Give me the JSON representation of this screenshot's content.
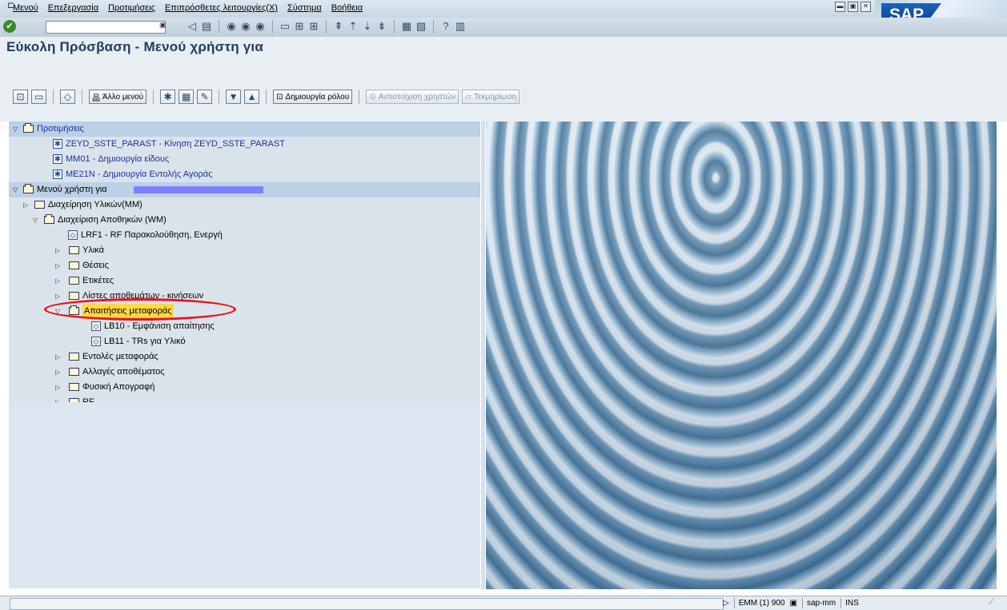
{
  "menubar": {
    "items": [
      "Μενού",
      "Επεξεργασία",
      "Προτιμήσεις",
      "Επιπρόσθετες λειτουργίες(X)",
      "Σύστημα",
      "Βοήθεια"
    ],
    "logo": "SAP"
  },
  "toolbar": {
    "command_value": ""
  },
  "title": "Εύκολη Πρόσβαση - Μενού χρήστη για",
  "app_toolbar": {
    "other_menu": "Άλλο μενού",
    "create_role": "Δημιουργία ρόλου",
    "assign_users": "Αντιστοίχιση χρηστών",
    "documentation": "Τεκμηρίωση"
  },
  "tree": {
    "favorites": "Προτιμήσεις",
    "fav1": "ZEYD_SSTE_PARAST - Κίνηση ZEYD_SSTE_PARAST",
    "fav2": "MM01 - Δημιουργία είδους",
    "fav3": "ME21N - Δημιουργία Εντολής Αγοράς",
    "user_menu": "Μενού χρήστη για",
    "mm": "Διαχείρηση Υλικών(MM)",
    "wm": "Διαχείριση Αποθηκών (WM)",
    "lrf1": "LRF1 - RF Παρακολούθηση, Ενεργή",
    "materials": "Υλικά",
    "bins": "Θέσεις",
    "labels": "Ετικέτες",
    "stock_lists": "Λίστες αποθεμάτων - κινήσεων",
    "transfer_req": "Απαιτήσεις μεταφοράς",
    "lb10": "LB10 - Εμφάνιση απαίτησης",
    "lb11": "LB11 - TRs για Υλικό",
    "transfer_orders": "Εντολές μεταφοράς",
    "stock_changes": "Αλλαγές αποθέματος",
    "inventory": "Φυσική Απογραφή",
    "rf": "RF"
  },
  "status": {
    "system": "EMM (1) 900",
    "server": "sap-mm",
    "mode": "INS"
  },
  "colors": {
    "highlight_ellipse": "#e8121a",
    "tree_bg": "#d6e0ea",
    "title": "#1d3d62"
  }
}
